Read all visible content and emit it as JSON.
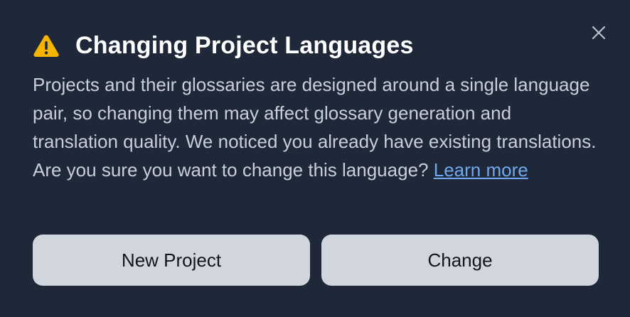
{
  "dialog": {
    "title": "Changing Project Languages",
    "body": "Projects and their glossaries are designed around a single language pair, so changing them may affect glossary generation and translation quality. We noticed you already have existing translations. Are you sure you want to change this language?",
    "learn_more_label": "Learn more",
    "icons": {
      "warning": "warning-triangle-icon",
      "close": "close-icon"
    }
  },
  "actions": {
    "new_project_label": "New Project",
    "change_label": "Change"
  },
  "colors": {
    "background": "#1f2838",
    "title_text": "#ffffff",
    "body_text": "#c9cfd9",
    "link": "#6fa9ee",
    "warning": "#f5b400",
    "button_bg": "#d1d6de",
    "button_text": "#11151c",
    "close_icon": "#b9c0cc"
  }
}
